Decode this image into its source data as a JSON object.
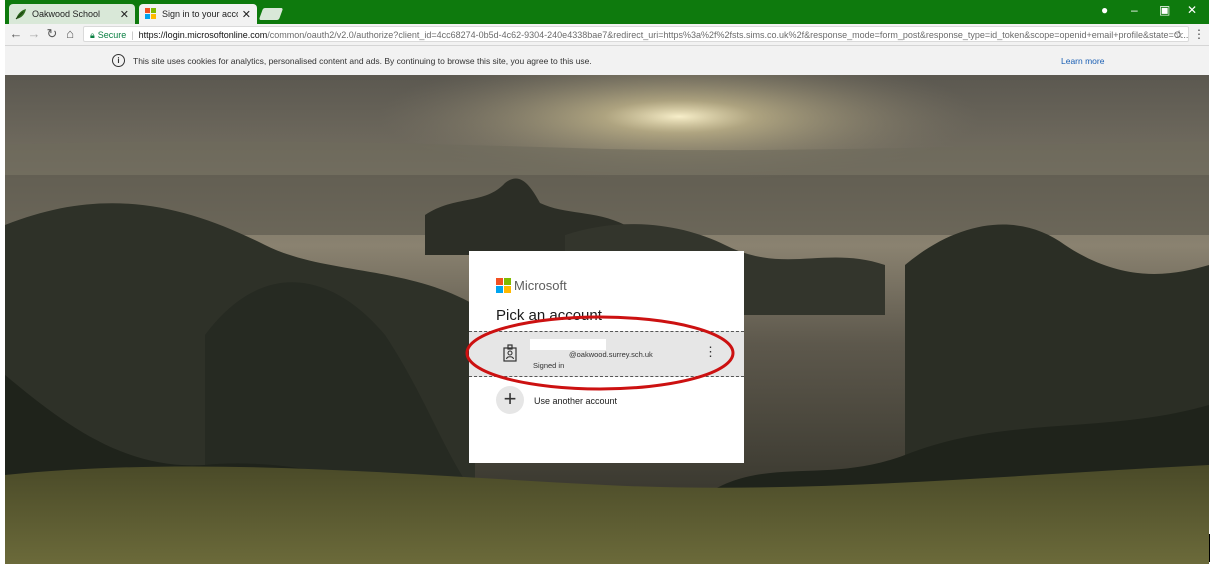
{
  "browser": {
    "tabs": [
      {
        "label": "Oakwood School",
        "favicon": "leaf-favicon",
        "active": false
      },
      {
        "label": "Sign in to your account",
        "favicon": "microsoft-favicon",
        "active": true
      }
    ],
    "url": {
      "secure_label": "Secure",
      "host": "https://login.microsoftonline.com",
      "rest": "/common/oauth2/v2.0/authorize?client_id=4cc68274-0b5d-4c62-9304-240e4338bae7&redirect_uri=https%3a%2f%2fsts.sims.co.uk%2f&response_mode=form_post&response_type=id_token&scope=openid+email+profile&state=O..."
    },
    "icons": [
      "back-icon",
      "forward-icon",
      "reload-icon",
      "home-icon",
      "lock-icon",
      "star-icon",
      "menu-icon",
      "close-icon",
      "profile-icon",
      "minimize-icon",
      "restore-icon"
    ]
  },
  "cookie_bar": {
    "text": "This site uses cookies for analytics, personalised content and ads. By continuing to browse this site, you agree to this use.",
    "learn_more": "Learn more"
  },
  "dialog": {
    "brand": "Microsoft",
    "title": "Pick an account",
    "account": {
      "email_suffix": "@oakwood.surrey.sch.uk",
      "status": "Signed in"
    },
    "other_account_label": "Use another account"
  },
  "colors": {
    "tab_strip": "#0e7a0d",
    "secure_green": "#0b8043",
    "highlight_ellipse": "#cc1111",
    "ms_red": "#f25022",
    "ms_green": "#7fba00",
    "ms_blue": "#00a4ef",
    "ms_yellow": "#ffb900"
  }
}
